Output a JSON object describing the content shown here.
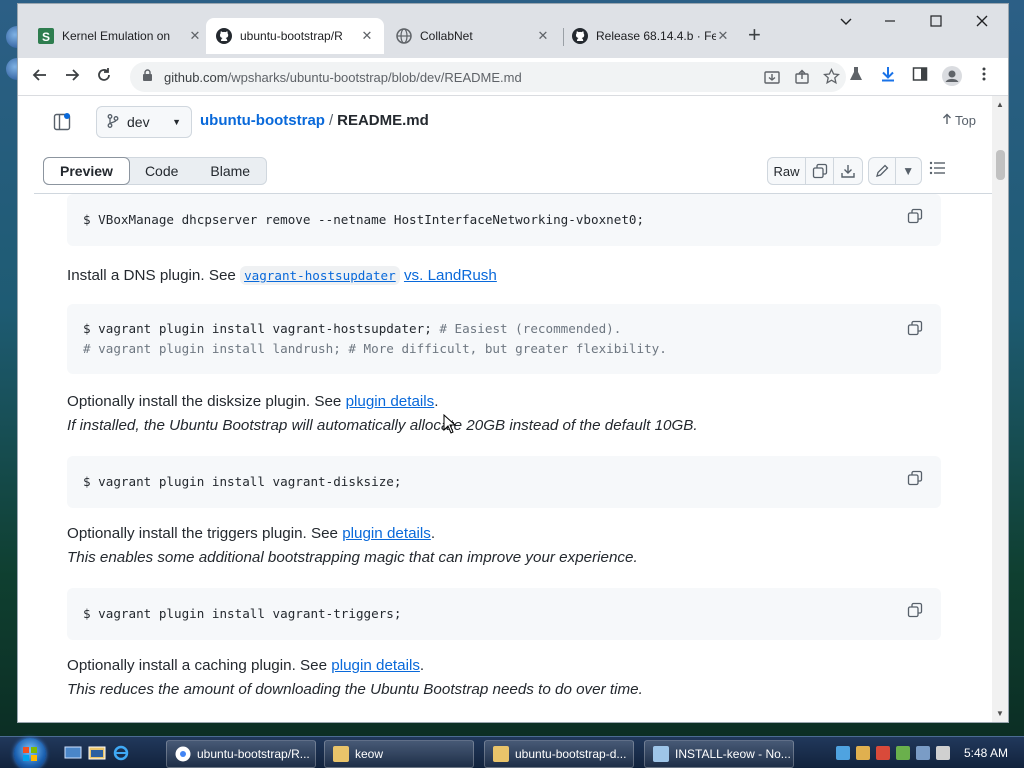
{
  "browser": {
    "tabs": [
      {
        "title": "Kernel Emulation on",
        "icon": "s-favicon",
        "active": false
      },
      {
        "title": "ubuntu-bootstrap/R",
        "icon": "github-icon",
        "active": true
      },
      {
        "title": "CollabNet",
        "icon": "globe-icon",
        "active": false
      },
      {
        "title": "Release 68.14.4.b · Fe",
        "icon": "github-icon",
        "active": false
      }
    ],
    "close_glyph": "✕",
    "new_tab_glyph": "+",
    "url_host": "github.com",
    "url_path": "/wpsharks/ubuntu-bootstrap/blob/dev/README.md"
  },
  "file_header": {
    "branch": "dev",
    "repo": "ubuntu-bootstrap",
    "separator": "/",
    "file": "README.md",
    "top_label": "Top"
  },
  "view_bar": {
    "tabs": [
      "Preview",
      "Code",
      "Blame"
    ],
    "raw_label": "Raw"
  },
  "content": {
    "code1": "$ VBoxManage dhcpserver remove --netname HostInterfaceNetworking-vboxnet0;",
    "p1_text": "Install a DNS plugin. See ",
    "p1_code_link": "vagrant-hostsupdater",
    "p1_link": "vs. LandRush",
    "code2_line1_cmd": "$ vagrant plugin install vagrant-hostsupdater;",
    "code2_line1_cm": " # Easiest (recommended).",
    "code2_line2_cm": "# vagrant plugin install landrush; # More difficult, but greater flexibility.",
    "p2_text": "Optionally install the disksize plugin. See ",
    "p2_link": "plugin details",
    "p2_end": ".",
    "p2_italic": "If installed, the Ubuntu Bootstrap will automatically allocate 20GB instead of the default 10GB.",
    "code3": "$ vagrant plugin install vagrant-disksize;",
    "p3_text": "Optionally install the triggers plugin. See ",
    "p3_link": "plugin details",
    "p3_end": ".",
    "p3_italic": "This enables some additional bootstrapping magic that can improve your experience.",
    "code4": "$ vagrant plugin install vagrant-triggers;",
    "p4_text": "Optionally install a caching plugin. See ",
    "p4_link": "plugin details",
    "p4_end": ".",
    "p4_italic": "This reduces the amount of downloading the Ubuntu Bootstrap needs to do over time."
  },
  "taskbar": {
    "items": [
      {
        "label": "ubuntu-bootstrap/R..."
      },
      {
        "label": "keow"
      },
      {
        "label": "ubuntu-bootstrap-d..."
      },
      {
        "label": "INSTALL-keow - No..."
      }
    ],
    "clock": "5:48 AM"
  },
  "colors": {
    "link": "#0969da",
    "text": "#24292f",
    "code_bg": "#f6f8fa"
  }
}
